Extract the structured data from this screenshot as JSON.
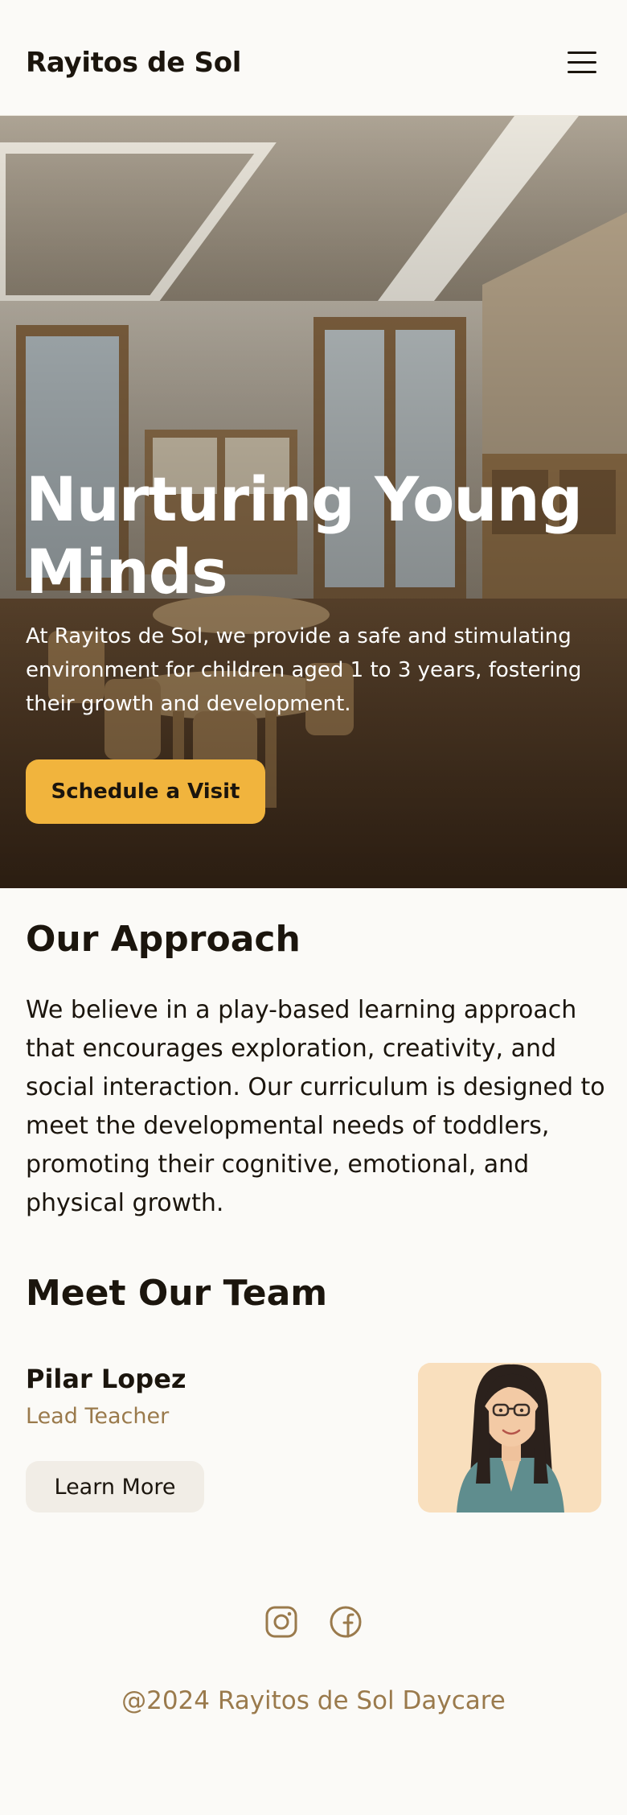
{
  "header": {
    "brand": "Rayitos de Sol",
    "menu_icon": "hamburger-menu-icon"
  },
  "hero": {
    "title": "Nurturing Young Minds",
    "text": "At Rayitos de Sol, we provide a safe and stimulating environment for children aged 1 to 3 years, fostering their growth and development.",
    "cta_label": "Schedule a Visit",
    "accent_color": "#f1b43d"
  },
  "approach": {
    "title": "Our Approach",
    "text": "We believe in a play-based learning approach that encourages exploration, creativity, and social interaction. Our curriculum is designed to meet the developmental needs of toddlers, promoting their cognitive, emotional, and physical growth."
  },
  "team": {
    "title": "Meet Our Team",
    "members": [
      {
        "name": "Pilar Lopez",
        "role": "Lead Teacher",
        "button_label": "Learn More"
      }
    ]
  },
  "footer": {
    "social_icons": [
      "instagram-icon",
      "facebook-icon"
    ],
    "copyright": "@2024 Rayitos de Sol Daycare",
    "text_color": "#9a7a4c"
  }
}
